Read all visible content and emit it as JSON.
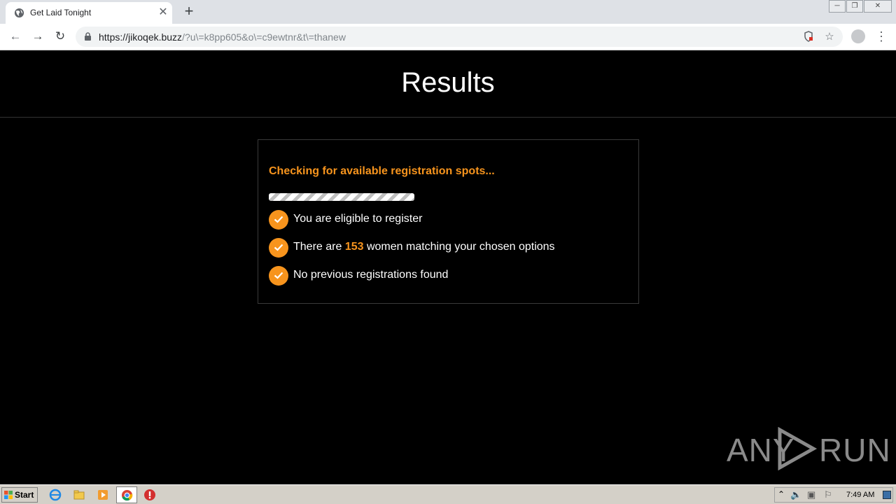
{
  "browser": {
    "tab_title": "Get Laid Tonight",
    "url_host": "https://jikoqek.buzz",
    "url_rest": "/?u\\=k8pp605&o\\=c9ewtnr&t\\=thanew"
  },
  "page": {
    "heading": "Results",
    "checking_text": "Checking for available registration spots...",
    "progress_percent": 100,
    "checks": [
      {
        "text": "You are eligible to register"
      },
      {
        "pre": "There are ",
        "count": "153",
        "post": " women matching your chosen options"
      },
      {
        "text": "No previous registrations found"
      }
    ],
    "watermark": {
      "left": "ANY",
      "right": "RUN"
    }
  },
  "taskbar": {
    "start_label": "Start",
    "clock": "7:49 AM"
  },
  "colors": {
    "accent": "#f7941d",
    "background": "#000000"
  }
}
